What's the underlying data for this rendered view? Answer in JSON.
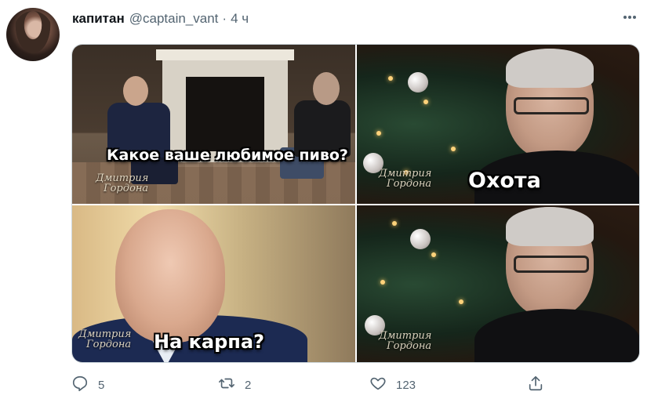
{
  "tweet": {
    "display_name": "капитан",
    "handle": "@captain_vant",
    "separator": "·",
    "time": "4 ч",
    "more_icon": "more-horizontal-icon"
  },
  "media": {
    "panels": [
      {
        "caption": "Какое ваше любимое пиво?",
        "watermark_line1": "Дмитрия",
        "watermark_line2": "Гордона"
      },
      {
        "caption": "Охота",
        "watermark_line1": "Дмитрия",
        "watermark_line2": "Гордона"
      },
      {
        "caption": "На карпа?",
        "watermark_line1": "Дмитрия",
        "watermark_line2": "Гордона"
      },
      {
        "caption": "",
        "watermark_line1": "Дмитрия",
        "watermark_line2": "Гордона"
      }
    ]
  },
  "actions": {
    "reply_count": "5",
    "retweet_count": "2",
    "like_count": "123",
    "reply_icon": "reply-icon",
    "retweet_icon": "retweet-icon",
    "like_icon": "heart-icon",
    "share_icon": "share-icon"
  },
  "colors": {
    "secondary_text": "#536471",
    "primary_text": "#0f1419",
    "border": "#cfd9de"
  }
}
